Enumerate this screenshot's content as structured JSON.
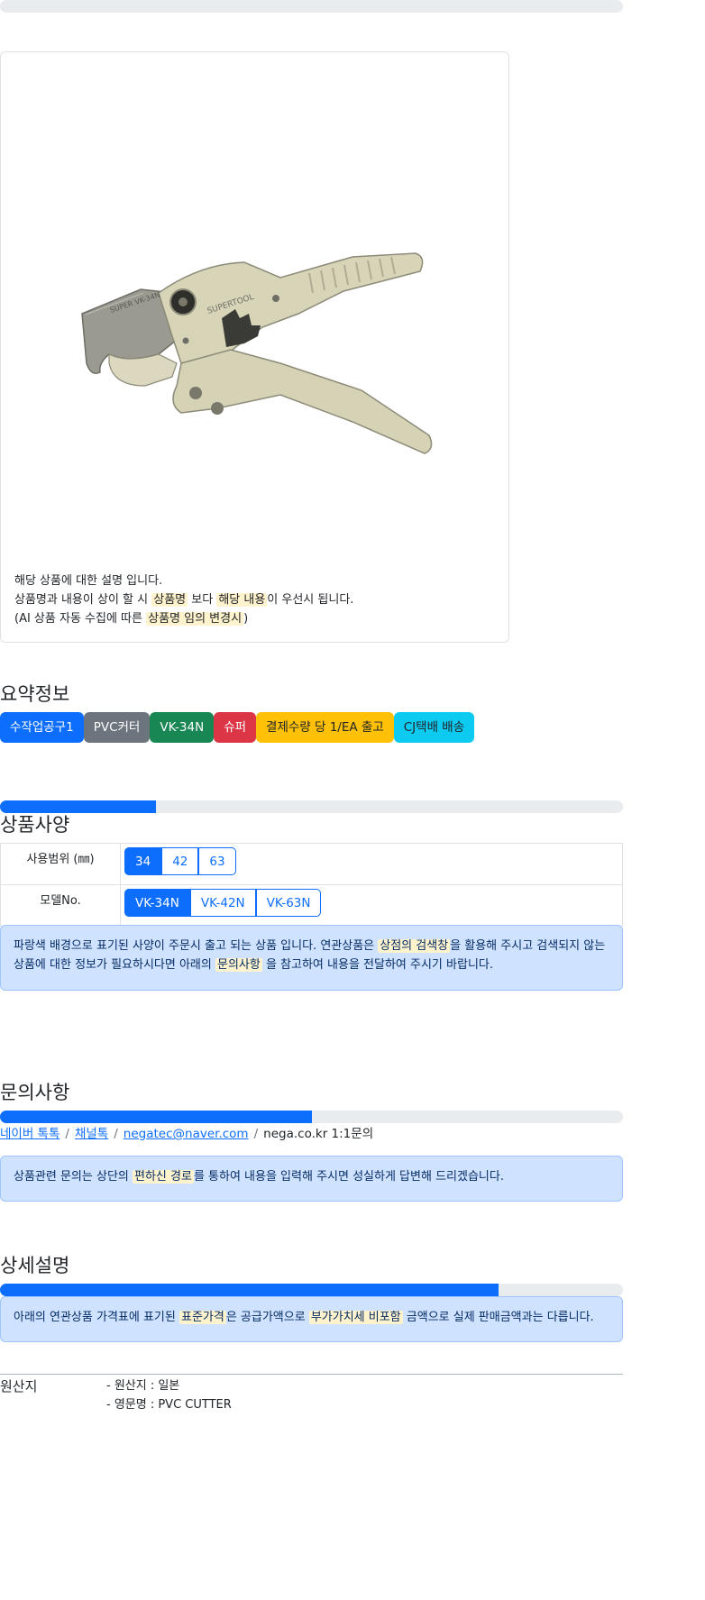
{
  "top_progress": {
    "value": 0
  },
  "product": {
    "image_icon": "pvc-pipe-cutter-image",
    "brand_text": "SUPERTOOL",
    "blade_text": "SUPER VK-34N",
    "description": {
      "line1": "해당 상품에 대한 설명 입니다.",
      "line2_a": "상품명과 내용이 상이 할 시 ",
      "line2_hl1": "상품명",
      "line2_b": " 보다 ",
      "line2_hl2": "해당 내용",
      "line2_c": "이 우선시 됩니다.",
      "line3_a": "(AI 상품 자동 수집에 따른 ",
      "line3_hl": "상품명 임의 변경시",
      "line3_b": ")"
    }
  },
  "summary": {
    "title": "요약정보",
    "badges": [
      "수작업공구1",
      "PVC커터",
      "VK-34N",
      "슈퍼",
      "결제수량 당 1/EA 출고",
      "CJ택배 배송"
    ]
  },
  "spec": {
    "progress": 0.25,
    "title": "상품사양",
    "rows": [
      {
        "label": "사용범위 (㎜)",
        "options": [
          "34",
          "42",
          "63"
        ],
        "selected": "34"
      },
      {
        "label": "모델No.",
        "options": [
          "VK-34N",
          "VK-42N",
          "VK-63N"
        ],
        "selected": "VK-34N"
      }
    ],
    "notice": {
      "a": "파랑색 배경으로 표기된 사양이 주문시 출고 되는 상품 입니다. 연관상품은 ",
      "hl1": "상점의 검색창",
      "b": "을 활용해 주시고 검색되지 않는 상품에 대한 정보가 필요하시다면 아래의 ",
      "hl2": "문의사항",
      "c": " 을 참고하여 내용을 전달하여 주시기 바랍니다."
    }
  },
  "inquiry": {
    "title": "문의사항",
    "progress": 0.5,
    "links": [
      "네이버 톡톡",
      "채널톡",
      "negatec@naver.com"
    ],
    "plain": "nega.co.kr 1:1문의",
    "notice": {
      "a": "상품관련 문의는 상단의 ",
      "hl": "편하신 경로",
      "b": "를 통하여 내용을 입력해 주시면 성실하게 답변해 드리겠습니다."
    }
  },
  "detail": {
    "title": "상세설명",
    "progress": 0.8,
    "notice": {
      "a": "아래의 연관상품 가격표에 표기된 ",
      "hl1": "표준가격",
      "b": "은 공급가액으로 ",
      "hl2": "부가가치세 비포함",
      "c": " 금액으로 실제 판매금액과는 다릅니다."
    }
  },
  "origin": {
    "label": "원산지",
    "items": [
      "- 원산지 : 일본",
      "- 영문명 : PVC CUTTER"
    ]
  }
}
